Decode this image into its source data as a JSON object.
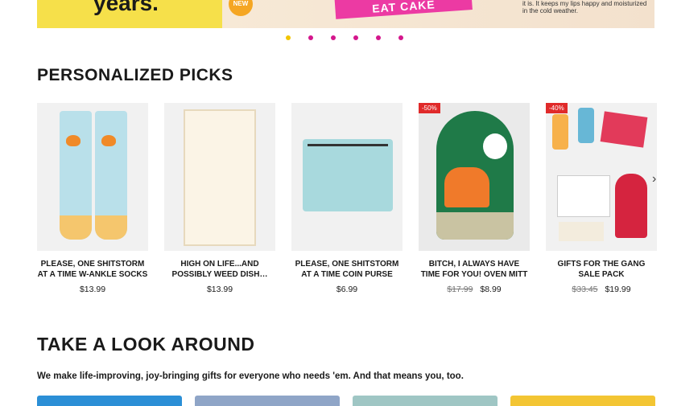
{
  "hero": {
    "years_text": "years.",
    "new_badge": "NEW",
    "cake_tag": "EAT CAKE",
    "quote_text": "it is. It keeps my lips happy and moisturized in the cold weather."
  },
  "carousel": {
    "dot_count": 6,
    "active_index": 0
  },
  "picks": {
    "title": "PERSONALIZED PICKS",
    "products": [
      {
        "name": "PLEASE, ONE SHITSTORM AT A TIME W-ANKLE SOCKS",
        "price": "$13.99",
        "was_price": "",
        "badge": ""
      },
      {
        "name": "HIGH ON LIFE...AND POSSIBLY WEED DISH…",
        "price": "$13.99",
        "was_price": "",
        "badge": ""
      },
      {
        "name": "PLEASE, ONE SHITSTORM AT A TIME COIN PURSE",
        "price": "$6.99",
        "was_price": "",
        "badge": ""
      },
      {
        "name": "BITCH, I ALWAYS HAVE TIME FOR YOU! OVEN MITT",
        "price": "$8.99",
        "was_price": "$17.99",
        "badge": "-50%"
      },
      {
        "name": "GIFTS FOR THE GANG SALE PACK",
        "price": "$19.99",
        "was_price": "$33.45",
        "badge": "-40%"
      }
    ],
    "next_icon": "chevron-right-icon"
  },
  "look_around": {
    "title": "TAKE A LOOK AROUND",
    "subtitle": "We make life-improving, joy-bringing gifts for everyone who needs 'em. And that means you, too.",
    "tile_colors": [
      "#2b8fd6",
      "#8fa5c7",
      "#9fc6c4",
      "#f3c533"
    ]
  },
  "colors": {
    "dot": "#d4168c",
    "dot_active": "#f2c500",
    "sale_badge": "#e02a2a"
  }
}
